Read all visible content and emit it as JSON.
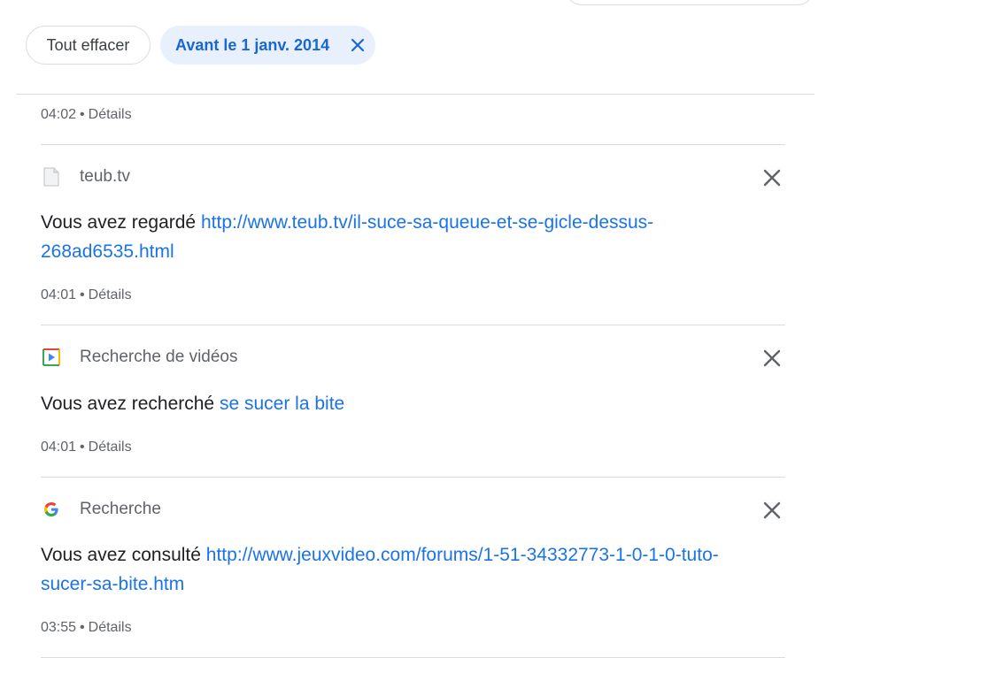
{
  "filters": {
    "clear_label": "Tout effacer",
    "active_filter_label": "Avant le 1 janv. 2014"
  },
  "first_meta": {
    "time": "04:02",
    "details": "Détails"
  },
  "items": [
    {
      "product": "teub.tv",
      "action": "Vous avez regardé",
      "link": "http://www.teub.tv/il-suce-sa-queue-et-se-gicle-dessus-268ad6535.html",
      "time": "04:01",
      "details": "Détails",
      "icon": "page-icon"
    },
    {
      "product": "Recherche de vidéos",
      "action": "Vous avez recherché",
      "link": "se sucer la bite",
      "time": "04:01",
      "details": "Détails",
      "icon": "video-search-icon"
    },
    {
      "product": "Recherche",
      "action": "Vous avez consulté",
      "link": "http://www.jeuxvideo.com/forums/1-51-34332773-1-0-1-0-tuto-sucer-sa-bite.htm",
      "time": "03:55",
      "details": "Détails",
      "icon": "google-icon"
    }
  ],
  "colors": {
    "link": "#1a73e8",
    "chip_active_bg": "#e8f0fe",
    "chip_active_text": "#1967d2",
    "divider": "#dadce0"
  }
}
